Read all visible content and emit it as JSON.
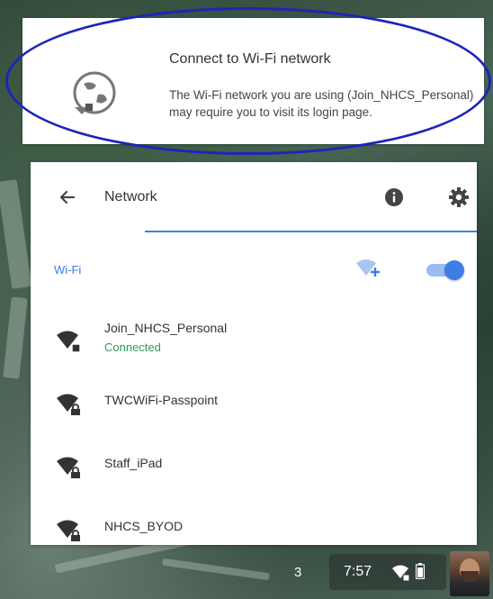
{
  "notification": {
    "title": "Connect to Wi-Fi network",
    "body": "The Wi-Fi network you are using (Join_NHCS_Personal) may require you to visit its login page.",
    "icon": "globe-wifi-icon"
  },
  "annotation": {
    "color": "#1c25b8"
  },
  "panel": {
    "title": "Network",
    "wifi_label": "Wi-Fi",
    "wifi_enabled": true,
    "accent": "#3d7ee6",
    "networks": [
      {
        "name": "Join_NHCS_Personal",
        "status": "Connected",
        "secured": false
      },
      {
        "name": "TWCWiFi-Passpoint",
        "status": "",
        "secured": true
      },
      {
        "name": "Staff_iPad",
        "status": "",
        "secured": true
      },
      {
        "name": "NHCS_BYOD",
        "status": "",
        "secured": true
      }
    ]
  },
  "shelf": {
    "notification_count": "3",
    "time": "7:57"
  }
}
